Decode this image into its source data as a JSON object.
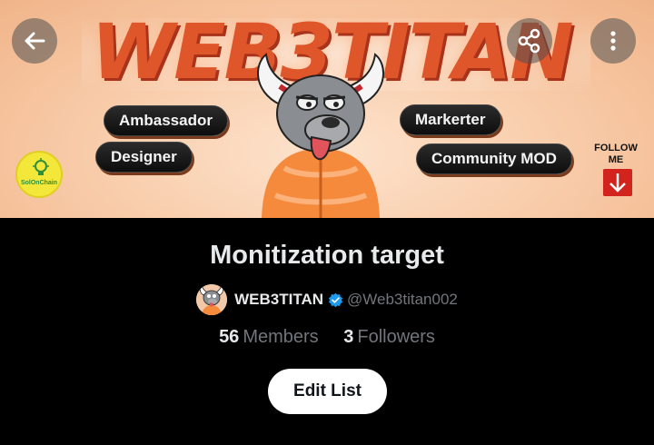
{
  "banner": {
    "brand_title": "WEB3TITAN",
    "roles": [
      "Ambassador",
      "Designer",
      "Markerter",
      "Community MOD"
    ],
    "logo_text": "SolOnChain",
    "follow_label": "FOLLOW ME",
    "brand_color": "#e0562b"
  },
  "header": {
    "back_icon": "arrow-left-icon",
    "share_icon": "share-icon",
    "more_icon": "more-vertical-icon"
  },
  "list": {
    "title": "Monitization target",
    "owner_name": "WEB3TITAN",
    "owner_handle": "@Web3titan002",
    "members_count": "56",
    "members_label": "Members",
    "followers_count": "3",
    "followers_label": "Followers",
    "edit_label": "Edit List"
  },
  "colors": {
    "background": "#000000",
    "text_primary": "#e7e9ea",
    "text_secondary": "#71767b",
    "verified": "#1d9bf0"
  }
}
